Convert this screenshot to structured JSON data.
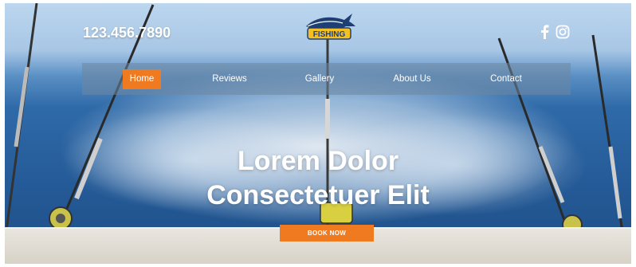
{
  "header": {
    "phone": "123.456.7890",
    "logo_text": "FISHING",
    "social": [
      {
        "icon": "facebook-icon"
      },
      {
        "icon": "instagram-icon"
      }
    ]
  },
  "nav": {
    "items": [
      {
        "label": "Home",
        "active": true
      },
      {
        "label": "Reviews",
        "active": false
      },
      {
        "label": "Gallery",
        "active": false
      },
      {
        "label": "About Us",
        "active": false
      },
      {
        "label": "Contact",
        "active": false
      }
    ]
  },
  "hero": {
    "headline_line1": "Lorem Dolor",
    "headline_line2": "Consectetuer Elit",
    "cta_label": "BOOK NOW"
  },
  "colors": {
    "accent": "#f07a1f",
    "nav_bar": "#6e87a0",
    "text": "#ffffff"
  }
}
